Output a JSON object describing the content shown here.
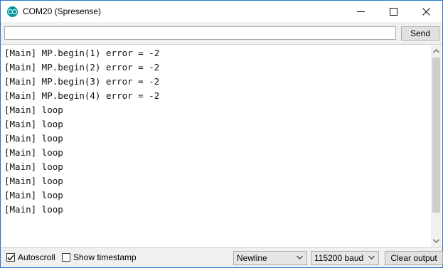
{
  "window": {
    "title": "COM20 (Spresense)",
    "icons": {
      "app": "arduino-icon",
      "minimize": "minimize-icon",
      "maximize": "maximize-icon",
      "close": "close-icon"
    }
  },
  "input": {
    "value": "",
    "send_label": "Send"
  },
  "log": {
    "lines": [
      "[Main] MP.begin(1) error = -2",
      "[Main] MP.begin(2) error = -2",
      "[Main] MP.begin(3) error = -2",
      "[Main] MP.begin(4) error = -2",
      "[Main] loop",
      "[Main] loop",
      "[Main] loop",
      "[Main] loop",
      "[Main] loop",
      "[Main] loop",
      "[Main] loop",
      "[Main] loop"
    ]
  },
  "status": {
    "autoscroll_label": "Autoscroll",
    "autoscroll_checked": true,
    "timestamp_label": "Show timestamp",
    "timestamp_checked": false,
    "line_ending": "Newline",
    "baud_rate": "115200 baud",
    "clear_label": "Clear output"
  }
}
